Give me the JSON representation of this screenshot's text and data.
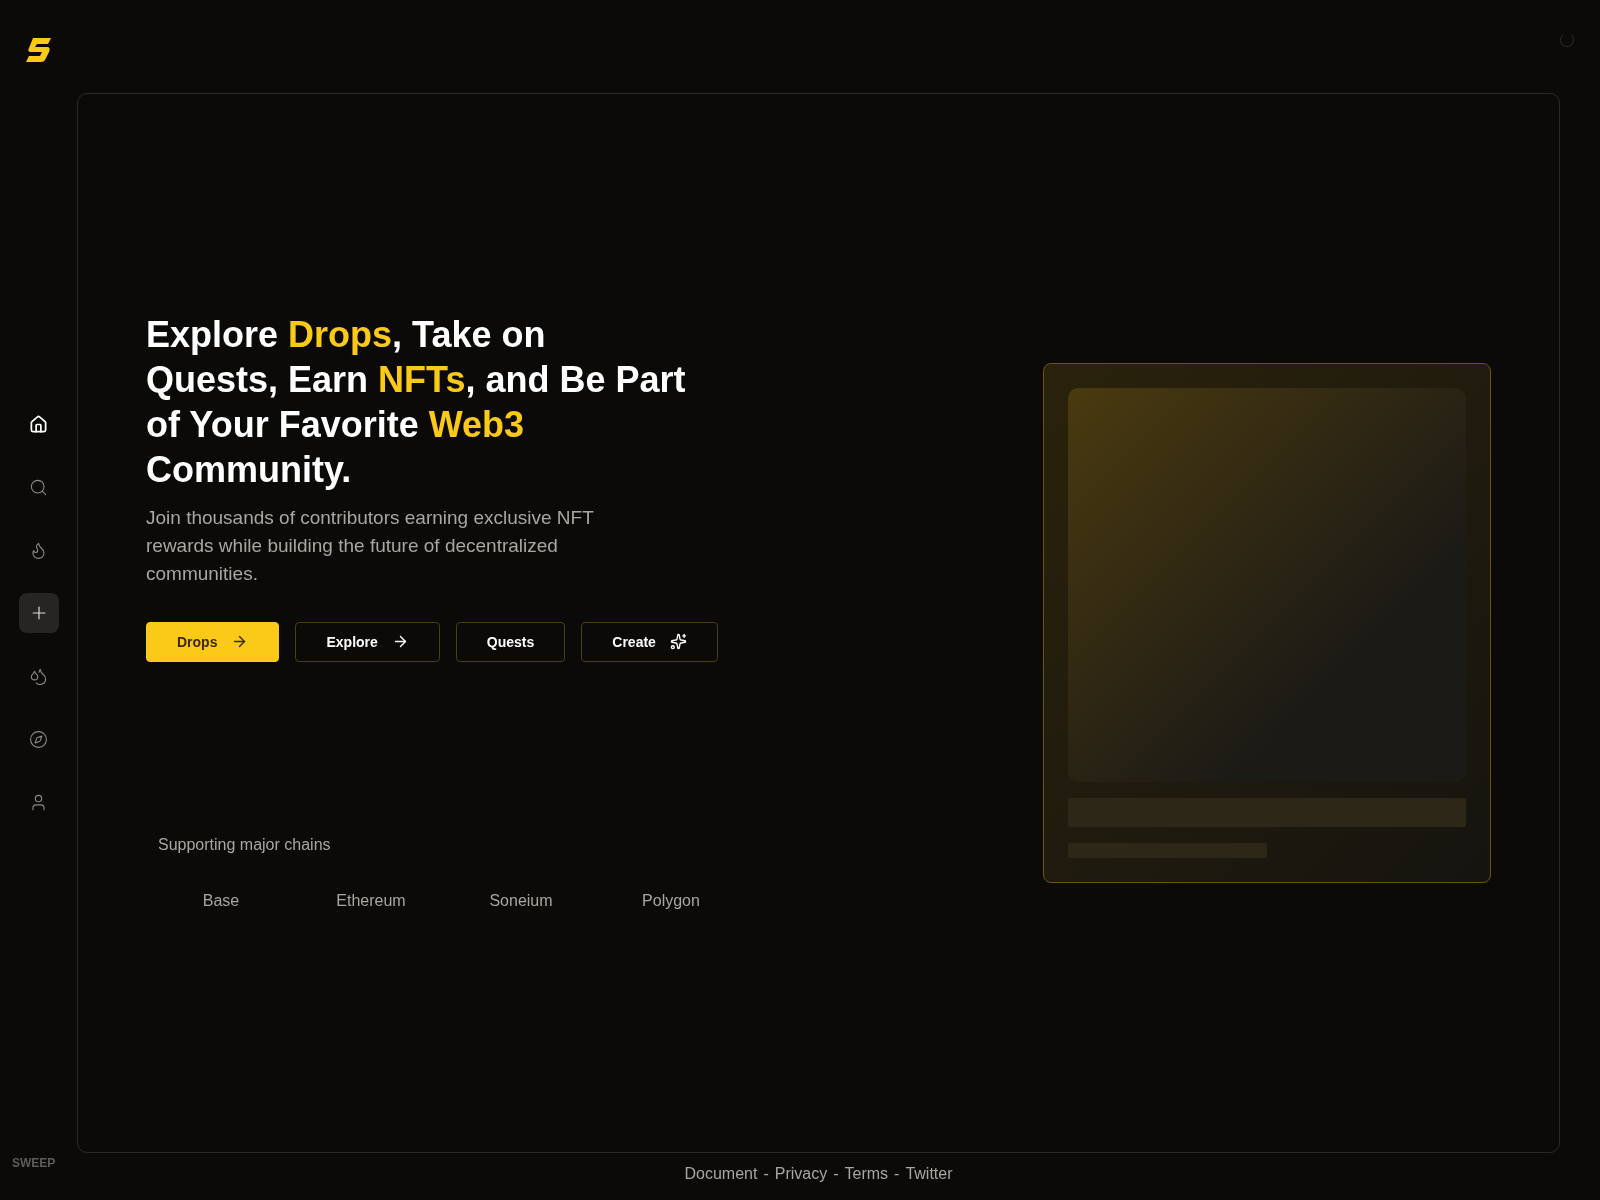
{
  "sidebar": {
    "items": [
      {
        "kind": "link",
        "selected": true
      },
      {
        "kind": "link",
        "selected": false
      },
      {
        "kind": "link",
        "selected": false
      },
      {
        "kind": "create",
        "selected": false
      },
      {
        "kind": "link",
        "selected": false
      },
      {
        "kind": "link",
        "selected": false
      },
      {
        "kind": "link",
        "selected": false
      }
    ],
    "brand": "SWEEP"
  },
  "hero": {
    "headline": [
      {
        "text": "Explore ",
        "highlight": false
      },
      {
        "text": "Drops",
        "highlight": true
      },
      {
        "text": ", Take on Quests, Earn ",
        "highlight": false
      },
      {
        "text": "NFTs",
        "highlight": true
      },
      {
        "text": ", and Be Part of Your Favorite ",
        "highlight": false
      },
      {
        "text": "Web3",
        "highlight": true
      },
      {
        "text": " Community.",
        "highlight": false
      }
    ],
    "subtitle": "Join thousands of contributors earning exclusive NFT rewards while building the future of decentralized communities.",
    "buttons": [
      {
        "label": "Drops",
        "kind": "primary"
      },
      {
        "label": "Explore",
        "kind": "link"
      },
      {
        "label": "Quests",
        "kind": "plain"
      },
      {
        "label": "Create",
        "kind": "create"
      }
    ],
    "chains_title": "Supporting major chains",
    "chains": [
      "Base",
      "Ethereum",
      "Soneium",
      "Polygon"
    ]
  },
  "footer": {
    "links": [
      "Document",
      "Privacy",
      "Terms",
      "Twitter"
    ],
    "separator": "-"
  }
}
